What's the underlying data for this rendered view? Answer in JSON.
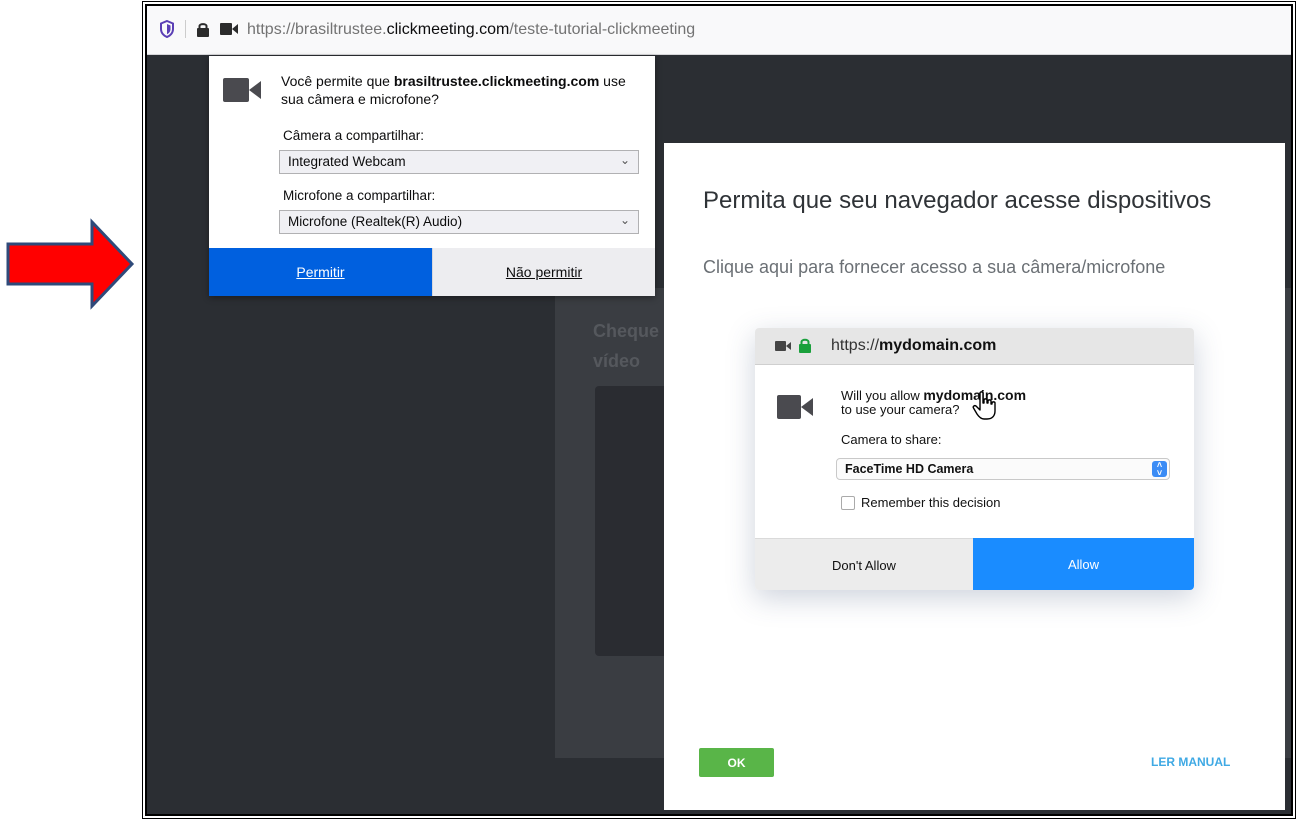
{
  "browser": {
    "url_prefix": "https://brasiltrustee.",
    "url_domain": "clickmeeting.com",
    "url_path": "/teste-tutorial-clickmeeting"
  },
  "permission_popup": {
    "question_prefix": "Você permite que ",
    "question_domain": "brasiltrustee.clickmeeting.com",
    "question_suffix": " use sua câmera e microfone?",
    "camera_label": "Câmera a compartilhar:",
    "camera_value": "Integrated Webcam",
    "mic_label": "Microfone a compartilhar:",
    "mic_value": "Microfone (Realtek(R) Audio)",
    "allow_label": "Permitir",
    "deny_label": "Não permitir"
  },
  "background_page": {
    "text": "Cheque vídeo"
  },
  "modal": {
    "title": "Permita que seu navegador acesse dispositivos",
    "subtitle": "Clique aqui para fornecer acesso a sua câmera/microfone",
    "ok_label": "OK",
    "manual_label": "LER MANUAL"
  },
  "illustration": {
    "url_prefix": "https://",
    "url_domain": "mydomain.com",
    "question_prefix": "Will you allow ",
    "question_domain": "mydomain.com",
    "question_suffix": "to use your camera?",
    "camera_label": "Camera to share:",
    "camera_value": "FaceTime HD Camera",
    "remember_label": "Remember this decision",
    "dont_allow_label": "Don't Allow",
    "allow_label": "Allow"
  },
  "colors": {
    "arrow_fill": "#ff0000",
    "arrow_stroke": "#2f4a7a",
    "firefox_blue": "#0060df",
    "ok_green": "#59b548",
    "manual_blue": "#3fa9e4",
    "mac_allow_blue": "#1a8cff",
    "page_dark": "#2b2e33"
  }
}
